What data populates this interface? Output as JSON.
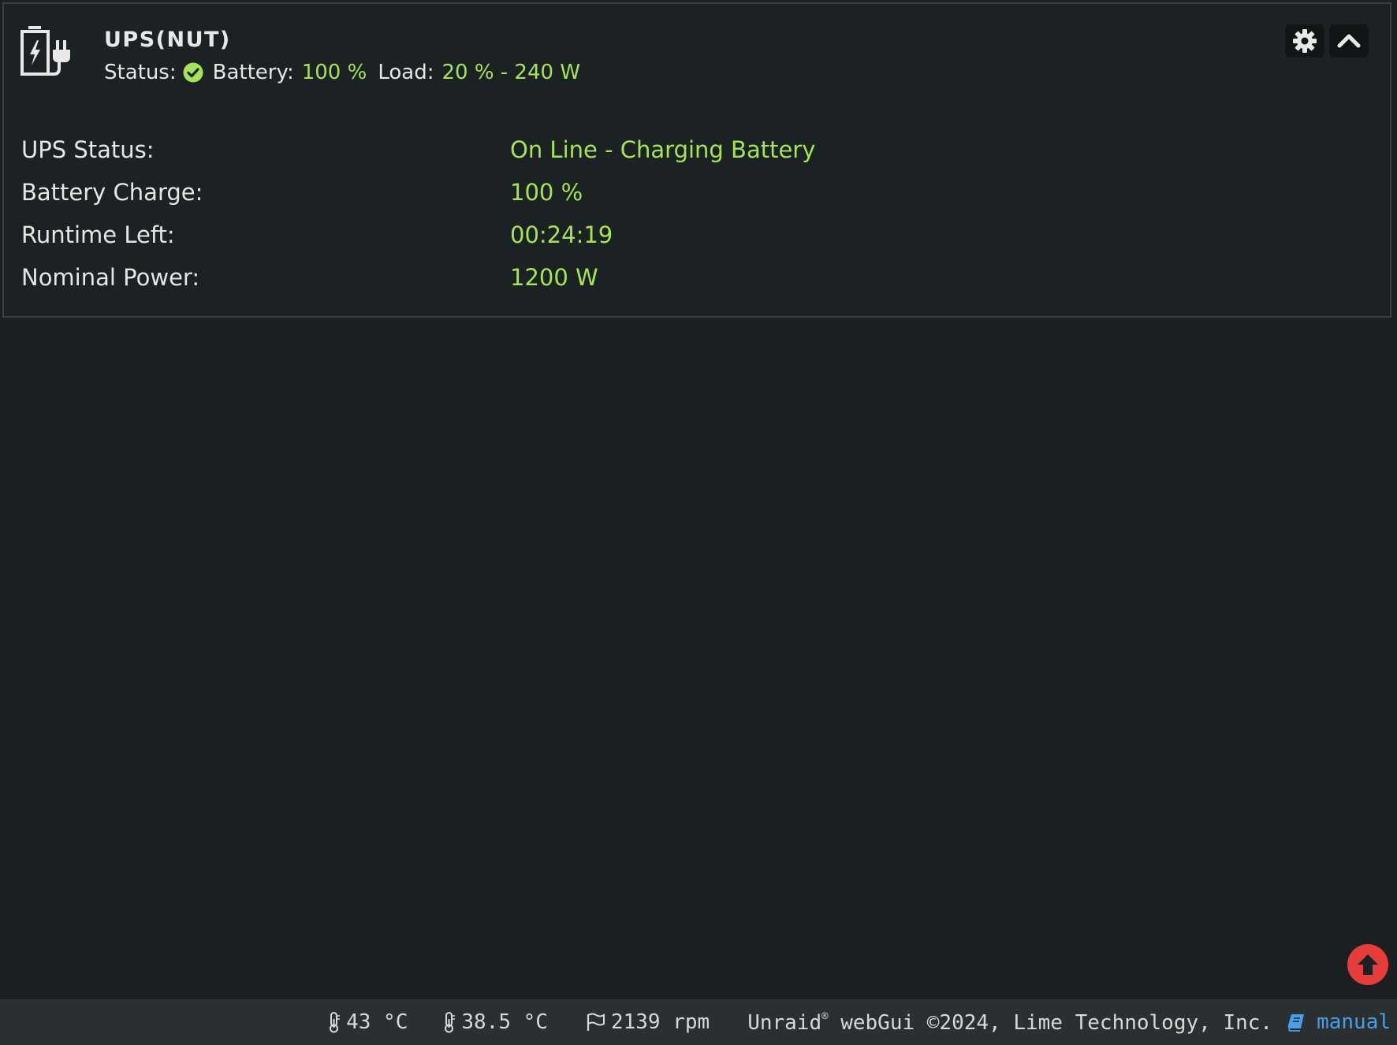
{
  "widget": {
    "title": "UPS(NUT)",
    "summary": {
      "status_label": "Status:",
      "battery_label": "Battery:",
      "battery_value": "100 %",
      "load_label": "Load:",
      "load_value": "20 % - 240 W"
    },
    "rows": [
      {
        "label": "UPS Status:",
        "value": "On Line - Charging Battery"
      },
      {
        "label": "Battery Charge:",
        "value": "100 %"
      },
      {
        "label": "Runtime Left:",
        "value": "00:24:19"
      },
      {
        "label": "Nominal Power:",
        "value": "1200 W"
      }
    ],
    "icons": {
      "widget": "battery-plug-icon",
      "status": "check-circle-icon",
      "settings": "gear-icon",
      "collapse": "chevron-up-icon"
    }
  },
  "footer": {
    "cpu_temp": "43 °C",
    "board_temp": "38.5 °C",
    "fan_speed": "2139 rpm",
    "brand": "Unraid",
    "reg_mark": "®",
    "copyright": " webGui ©2024, Lime Technology, Inc.",
    "manual_label": "manual"
  },
  "colors": {
    "background": "#1d2022",
    "accent_green": "#a5e35a",
    "link_blue": "#4a9ee6",
    "scroll_button": "#e53c3c"
  }
}
